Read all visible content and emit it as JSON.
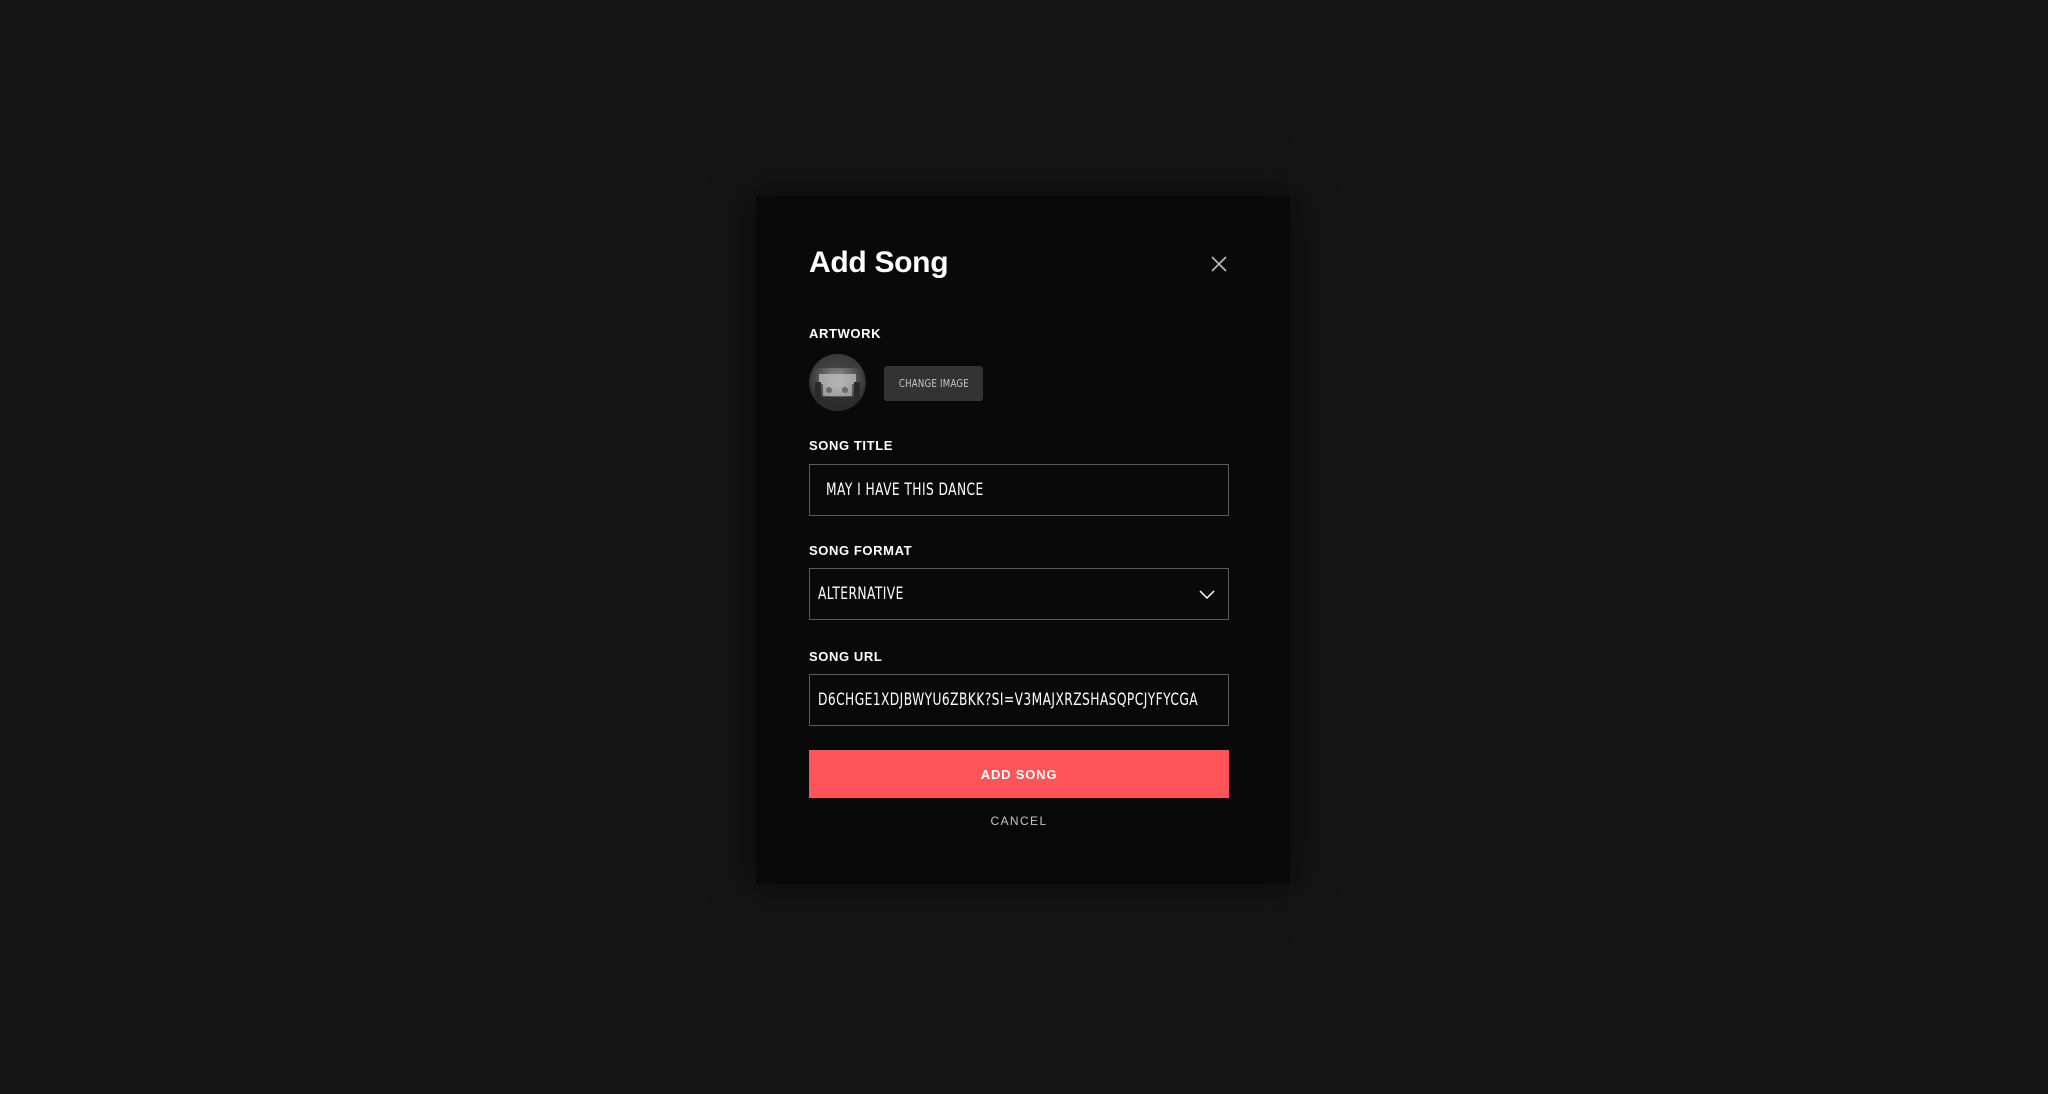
{
  "modal": {
    "title": "Add Song",
    "close_icon": "close-icon"
  },
  "artwork": {
    "label": "ARTWORK",
    "change_image_label": "CHANGE IMAGE"
  },
  "song_title": {
    "label": "SONG TITLE",
    "value": "MAY I HAVE THIS DANCE"
  },
  "song_format": {
    "label": "SONG FORMAT",
    "selected": "ALTERNATIVE",
    "icon": "chevron-down-icon"
  },
  "song_url": {
    "label": "SONG URL",
    "value": "D6CHGE1XDJBWYU6ZBKK?SI=V3MAJXRZSHASQPCJYFYCGA"
  },
  "actions": {
    "add_song_label": "ADD SONG",
    "cancel_label": "CANCEL"
  },
  "colors": {
    "backdrop": "#141414",
    "modal_bg": "#090909",
    "accent": "#ff5457",
    "input_border": "#5a5a5a",
    "secondary_button": "#333333"
  }
}
